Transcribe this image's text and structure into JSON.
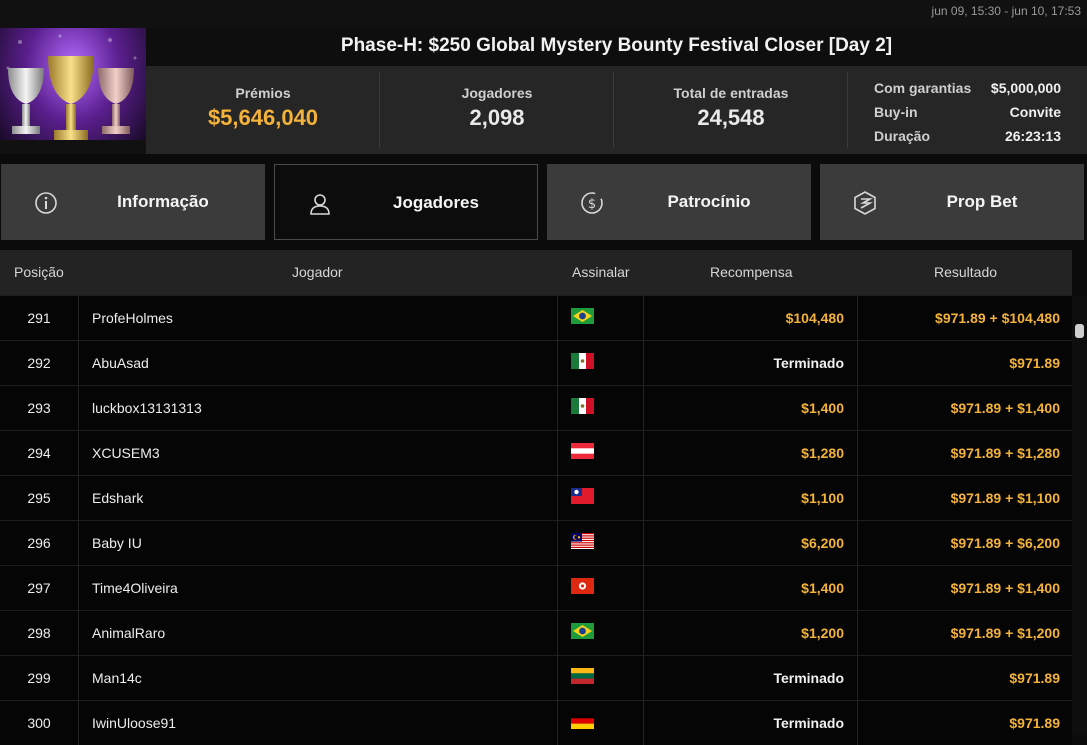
{
  "date_range": "jun 09, 15:30 - jun 10, 17:53",
  "tournament": {
    "title": "Phase-H: $250 Global Mystery Bounty Festival Closer [Day 2]",
    "prizes_label": "Prémios",
    "prizes_value": "$5,646,040",
    "players_label": "Jogadores",
    "players_value": "2,098",
    "entries_label": "Total de entradas",
    "entries_value": "24,548",
    "details": [
      {
        "label": "Com garantias",
        "value": "$5,000,000"
      },
      {
        "label": "Buy-in",
        "value": "Convite"
      },
      {
        "label": "Duração",
        "value": "26:23:13"
      }
    ]
  },
  "tabs": [
    {
      "label": "Informação",
      "icon": "info-icon"
    },
    {
      "label": "Jogadores",
      "icon": "user-icon"
    },
    {
      "label": "Patrocínio",
      "icon": "dollar-coin-icon"
    },
    {
      "label": "Prop Bet",
      "icon": "prop-bet-icon"
    }
  ],
  "table": {
    "headers": {
      "position": "Posição",
      "player": "Jogador",
      "sign": "Assinalar",
      "reward": "Recompensa",
      "result": "Resultado"
    },
    "rows": [
      {
        "pos": "291",
        "player": "ProfeHolmes",
        "flag": "brazil",
        "reward": "$104,480",
        "result": "$971.89 + $104,480"
      },
      {
        "pos": "292",
        "player": "AbuAsad",
        "flag": "mexico",
        "reward": "Terminado",
        "result": "$971.89"
      },
      {
        "pos": "293",
        "player": "luckbox13131313",
        "flag": "mexico",
        "reward": "$1,400",
        "result": "$971.89 + $1,400"
      },
      {
        "pos": "294",
        "player": "XCUSEM3",
        "flag": "austria",
        "reward": "$1,280",
        "result": "$971.89 + $1,280"
      },
      {
        "pos": "295",
        "player": "Edshark",
        "flag": "taiwan",
        "reward": "$1,100",
        "result": "$971.89 + $1,100"
      },
      {
        "pos": "296",
        "player": "Baby IU",
        "flag": "malaysia",
        "reward": "$6,200",
        "result": "$971.89 + $6,200"
      },
      {
        "pos": "297",
        "player": "Time4Oliveira",
        "flag": "hong-kong",
        "reward": "$1,400",
        "result": "$971.89 + $1,400"
      },
      {
        "pos": "298",
        "player": "AnimalRaro",
        "flag": "brazil",
        "reward": "$1,200",
        "result": "$971.89 + $1,200"
      },
      {
        "pos": "299",
        "player": "Man14c",
        "flag": "lithuania",
        "reward": "Terminado",
        "result": "$971.89"
      },
      {
        "pos": "300",
        "player": "IwinUloose91",
        "flag": "germany",
        "reward": "Terminado",
        "result": "$971.89"
      }
    ]
  },
  "colors": {
    "gold": "#f3b23a",
    "tab_bg": "#3b3b3b",
    "active_tab_bg": "#0c0c0c"
  }
}
